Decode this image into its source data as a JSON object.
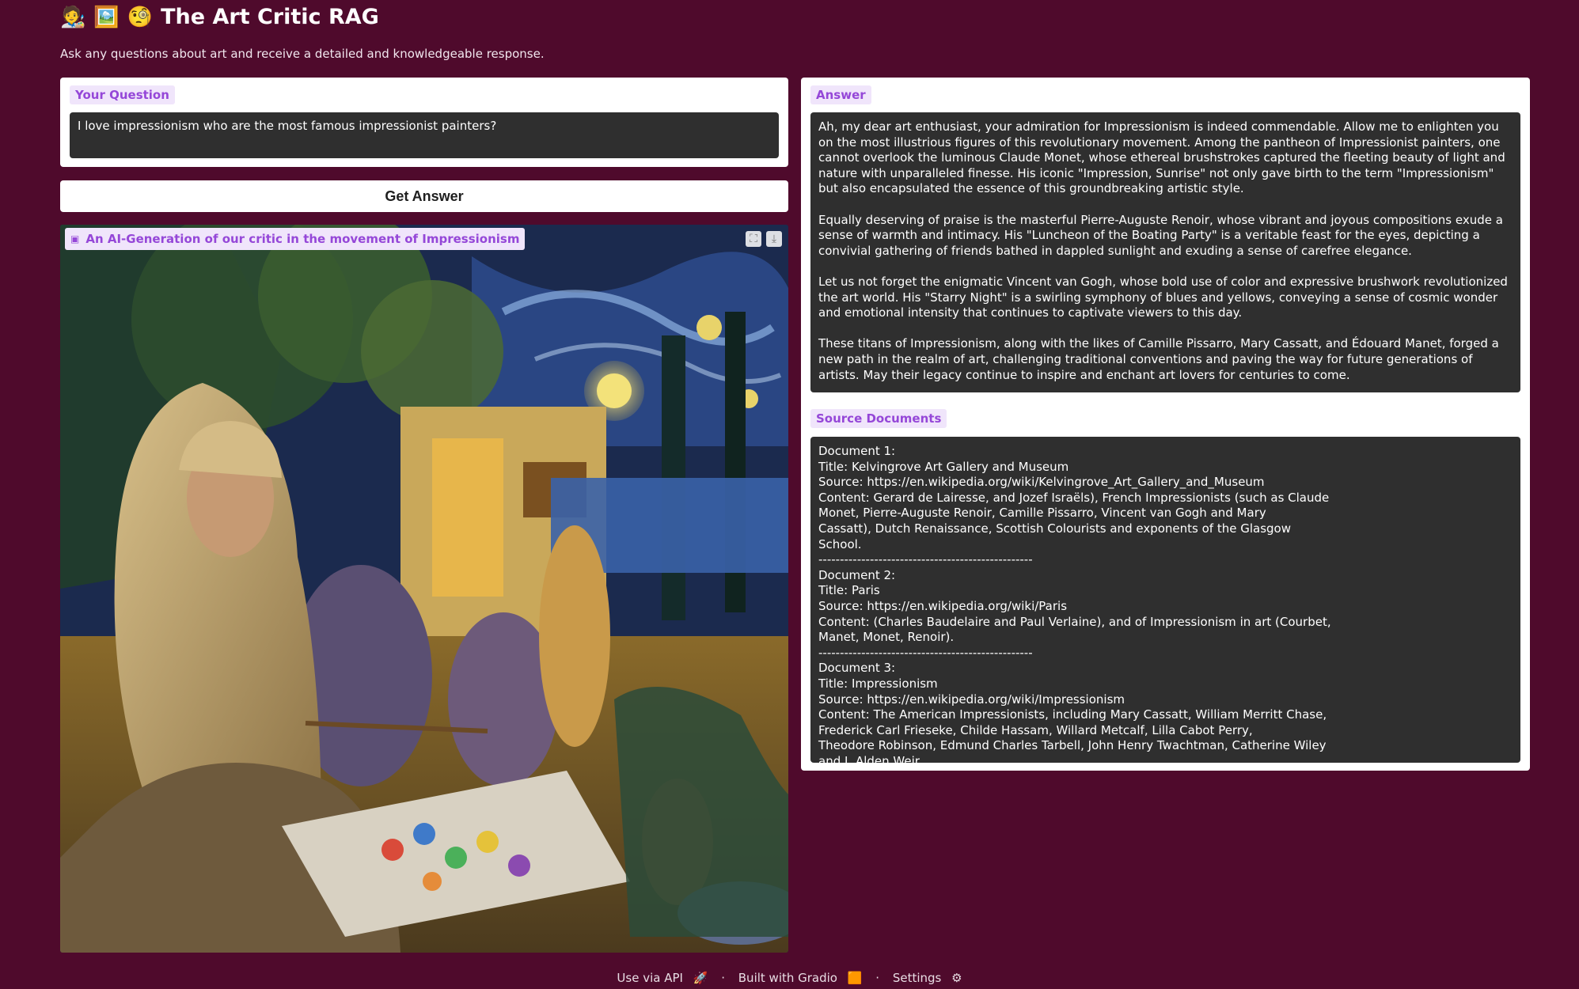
{
  "app": {
    "header_emojis": [
      "🧑‍🎨",
      "🖼️",
      "🧐"
    ],
    "title": "The Art Critic RAG",
    "subtitle": "Ask any questions about art and receive a detailed and knowledgeable response."
  },
  "question": {
    "label": "Your Question",
    "value": "I love impressionism who are the most famous impressionist painters?"
  },
  "button": {
    "label": "Get Answer"
  },
  "image": {
    "label": "An AI-Generation of our critic in the movement of Impressionism",
    "icons": [
      "image-icon",
      "fullscreen-icon",
      "download-icon"
    ]
  },
  "answer": {
    "label": "Answer",
    "paragraphs": [
      "Ah, my dear art enthusiast, your admiration for Impressionism is indeed commendable. Allow me to enlighten you on the most illustrious figures of this revolutionary movement. Among the pantheon of Impressionist painters, one cannot overlook the luminous Claude Monet, whose ethereal brushstrokes captured the fleeting beauty of light and nature with unparalleled finesse. His iconic \"Impression, Sunrise\" not only gave birth to the term \"Impressionism\" but also encapsulated the essence of this groundbreaking artistic style.",
      "Equally deserving of praise is the masterful Pierre-Auguste Renoir, whose vibrant and joyous compositions exude a sense of warmth and intimacy. His \"Luncheon of the Boating Party\" is a veritable feast for the eyes, depicting a convivial gathering of friends bathed in dappled sunlight and exuding a sense of carefree elegance.",
      "Let us not forget the enigmatic Vincent van Gogh, whose bold use of color and expressive brushwork revolutionized the art world. His \"Starry Night\" is a swirling symphony of blues and yellows, conveying a sense of cosmic wonder and emotional intensity that continues to captivate viewers to this day.",
      "These titans of Impressionism, along with the likes of Camille Pissarro, Mary Cassatt, and Édouard Manet, forged a new path in the realm of art, challenging traditional conventions and paving the way for future generations of artists. May their legacy continue to inspire and enchant art lovers for centuries to come."
    ]
  },
  "sources": {
    "label": "Source Documents",
    "lines": [
      "Document 1:",
      "Title: Kelvingrove Art Gallery and Museum",
      "Source: https://en.wikipedia.org/wiki/Kelvingrove_Art_Gallery_and_Museum",
      "Content: Gerard de Lairesse, and Jozef Israëls), French Impressionists (such as Claude",
      "Monet, Pierre-Auguste Renoir, Camille Pissarro, Vincent van Gogh and Mary",
      "Cassatt), Dutch Renaissance, Scottish Colourists and exponents of the Glasgow",
      "School.",
      "--------------------------------------------------",
      "Document 2:",
      "Title: Paris",
      "Source: https://en.wikipedia.org/wiki/Paris",
      "Content: (Charles Baudelaire and Paul Verlaine), and of Impressionism in art (Courbet,",
      "Manet, Monet, Renoir).",
      "--------------------------------------------------",
      "Document 3:",
      "Title: Impressionism",
      "Source: https://en.wikipedia.org/wiki/Impressionism",
      "Content: The American Impressionists, including Mary Cassatt, William Merritt Chase,",
      "Frederick Carl Frieseke, Childe Hassam, Willard Metcalf, Lilla Cabot Perry,",
      "Theodore Robinson, Edmund Charles Tarbell, John Henry Twachtman, Catherine Wiley",
      "and J. Alden Weir."
    ]
  },
  "footer": {
    "api": "Use via API",
    "api_emoji": "🚀",
    "built": "Built with Gradio",
    "built_emoji": "🟧",
    "settings": "Settings",
    "settings_emoji": "⚙",
    "separator": "·"
  }
}
